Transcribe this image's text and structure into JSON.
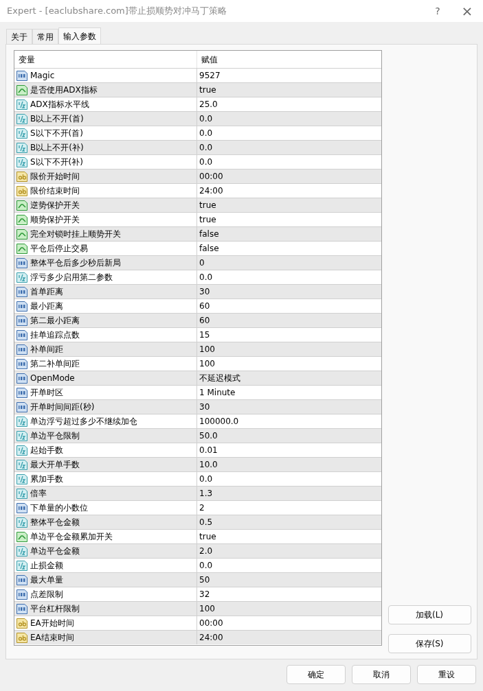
{
  "window": {
    "title": "Expert - [eaclubshare.com]带止损顺势对冲马丁策略",
    "help": "?",
    "close": "×"
  },
  "tabs": [
    {
      "label": "关于",
      "selected": false
    },
    {
      "label": "常用",
      "selected": false
    },
    {
      "label": "输入参数",
      "selected": true
    }
  ],
  "table": {
    "columns": [
      "变量",
      "赋值"
    ],
    "rows": [
      {
        "kind": "int",
        "name": "Magic",
        "value": "9527"
      },
      {
        "kind": "bool",
        "name": "是否使用ADX指标",
        "value": "true"
      },
      {
        "kind": "double",
        "name": "ADX指标水平线",
        "value": "25.0"
      },
      {
        "kind": "double",
        "name": "B以上不开(首)",
        "value": "0.0"
      },
      {
        "kind": "double",
        "name": "S以下不开(首)",
        "value": "0.0"
      },
      {
        "kind": "double",
        "name": "B以上不开(补)",
        "value": "0.0"
      },
      {
        "kind": "double",
        "name": "S以下不开(补)",
        "value": "0.0"
      },
      {
        "kind": "string",
        "name": "限价开始时间",
        "value": "00:00"
      },
      {
        "kind": "string",
        "name": "限价结束时间",
        "value": "24:00"
      },
      {
        "kind": "bool",
        "name": "逆势保护开关",
        "value": "true"
      },
      {
        "kind": "bool",
        "name": "顺势保护开关",
        "value": "true"
      },
      {
        "kind": "bool",
        "name": "完全对锁时挂上顺势开关",
        "value": "false"
      },
      {
        "kind": "bool",
        "name": "平仓后停止交易",
        "value": "false"
      },
      {
        "kind": "int",
        "name": "整体平仓后多少秒后新局",
        "value": "0"
      },
      {
        "kind": "double",
        "name": "浮亏多少启用第二参数",
        "value": "0.0"
      },
      {
        "kind": "int",
        "name": "首单距离",
        "value": "30"
      },
      {
        "kind": "int",
        "name": "最小距离",
        "value": "60"
      },
      {
        "kind": "int",
        "name": "第二最小距离",
        "value": "60"
      },
      {
        "kind": "int",
        "name": "挂单追踪点数",
        "value": "15"
      },
      {
        "kind": "int",
        "name": "补单间距",
        "value": "100"
      },
      {
        "kind": "int",
        "name": "第二补单间距",
        "value": "100"
      },
      {
        "kind": "int",
        "name": "OpenMode",
        "value": "不延迟模式"
      },
      {
        "kind": "int",
        "name": "开单时区",
        "value": "1 Minute"
      },
      {
        "kind": "int",
        "name": "开单时间间距(秒)",
        "value": "30"
      },
      {
        "kind": "double",
        "name": "单边浮亏超过多少不继续加仓",
        "value": "100000.0"
      },
      {
        "kind": "double",
        "name": "单边平仓限制",
        "value": "50.0"
      },
      {
        "kind": "double",
        "name": "起始手数",
        "value": "0.01"
      },
      {
        "kind": "double",
        "name": "最大开单手数",
        "value": "10.0"
      },
      {
        "kind": "double",
        "name": "累加手数",
        "value": "0.0"
      },
      {
        "kind": "double",
        "name": "倍率",
        "value": "1.3"
      },
      {
        "kind": "int",
        "name": "下单量的小数位",
        "value": "2"
      },
      {
        "kind": "double",
        "name": "整体平仓金额",
        "value": "0.5"
      },
      {
        "kind": "bool",
        "name": "单边平仓金额累加开关",
        "value": "true"
      },
      {
        "kind": "double",
        "name": "单边平仓金额",
        "value": "2.0"
      },
      {
        "kind": "double",
        "name": "止损金额",
        "value": "0.0"
      },
      {
        "kind": "int",
        "name": "最大单量",
        "value": "50"
      },
      {
        "kind": "int",
        "name": "点差限制",
        "value": "32"
      },
      {
        "kind": "int",
        "name": "平台杠杆限制",
        "value": "100"
      },
      {
        "kind": "string",
        "name": "EA开始时间",
        "value": "00:00"
      },
      {
        "kind": "string",
        "name": "EA结束时间",
        "value": "24:00"
      }
    ]
  },
  "side_buttons": [
    "加载(L)",
    "保存(S)"
  ],
  "bottom_buttons": [
    "确定",
    "取消",
    "重设"
  ]
}
